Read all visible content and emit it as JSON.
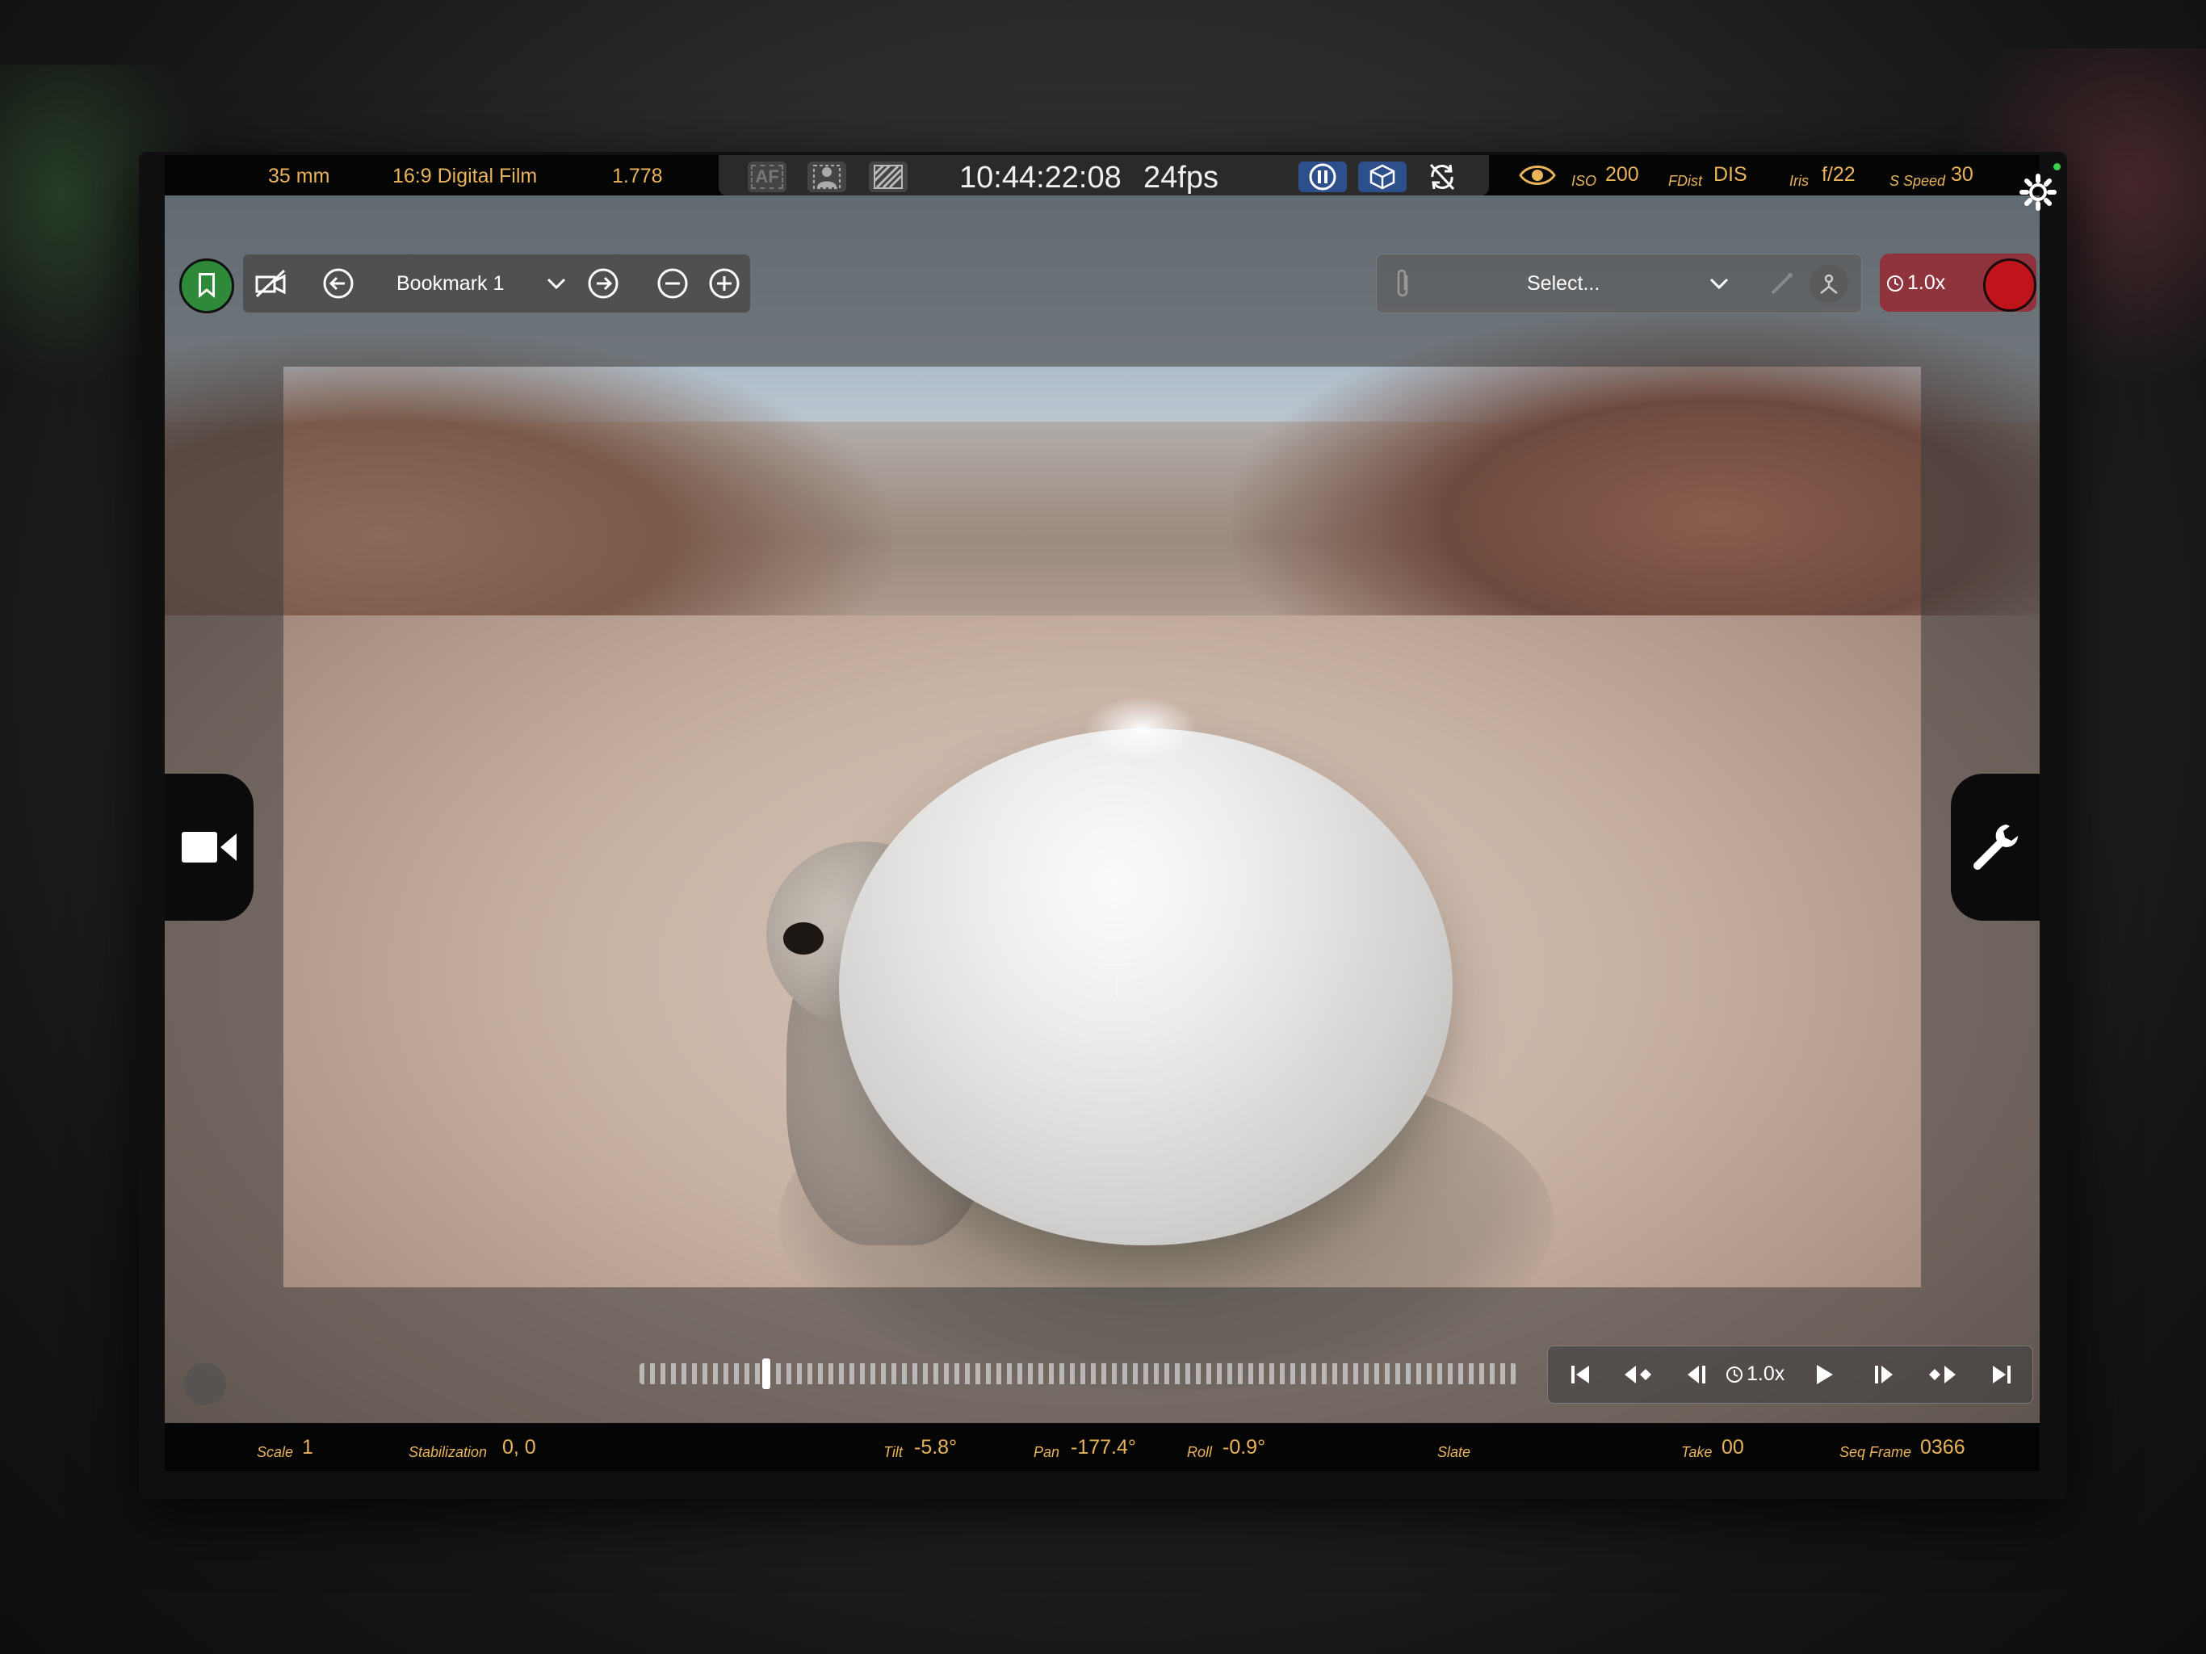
{
  "top_bar": {
    "focal_length": "35 mm",
    "format": "16:9 Digital Film",
    "aspect_ratio": "1.778",
    "af_label": "AF",
    "timecode": "10:44:22:08",
    "fps": "24fps",
    "iso_label": "ISO",
    "iso_value": "200",
    "fdist_label": "FDist",
    "fdist_value": "DIS",
    "iris_label": "Iris",
    "iris_value": "f/22",
    "sspeed_label": "S Speed",
    "sspeed_value": "30"
  },
  "toolbar": {
    "bookmark_name": "Bookmark 1",
    "select_placeholder": "Select...",
    "record_speed": "1.0x"
  },
  "transport": {
    "speed": "1.0x",
    "scrub_position_pct": 14
  },
  "bottom_bar": {
    "scale_label": "Scale",
    "scale_value": "1",
    "stabilization_label": "Stabilization",
    "stabilization_value": "0, 0",
    "tilt_label": "Tilt",
    "tilt_value": "-5.8°",
    "pan_label": "Pan",
    "pan_value": "-177.4°",
    "roll_label": "Roll",
    "roll_value": "-0.9°",
    "slate_label": "Slate",
    "take_label": "Take",
    "take_value": "00",
    "seq_frame_label": "Seq Frame",
    "seq_frame_value": "0366"
  },
  "colors": {
    "accent_amber": "#e8b35b",
    "bookmark_green": "#2e8a3a",
    "record_red": "#c0141c",
    "toggle_blue": "#2d4f8c"
  },
  "icons": [
    "bookmark-icon",
    "camera-off-icon",
    "arrow-left-icon",
    "chevron-down-icon",
    "arrow-right-icon",
    "minus-circle-icon",
    "plus-circle-icon",
    "paperclip-icon",
    "wand-icon",
    "rig-icon",
    "clock-icon",
    "video-camera-icon",
    "wrench-icon",
    "eye-icon",
    "settings-gear-icon",
    "af-icon",
    "person-icon",
    "zebra-icon",
    "pause-icon",
    "cube-icon",
    "sync-icon",
    "skip-start-icon",
    "step-back-key-icon",
    "frame-back-icon",
    "play-icon",
    "frame-forward-icon",
    "step-forward-key-icon",
    "skip-end-icon"
  ]
}
